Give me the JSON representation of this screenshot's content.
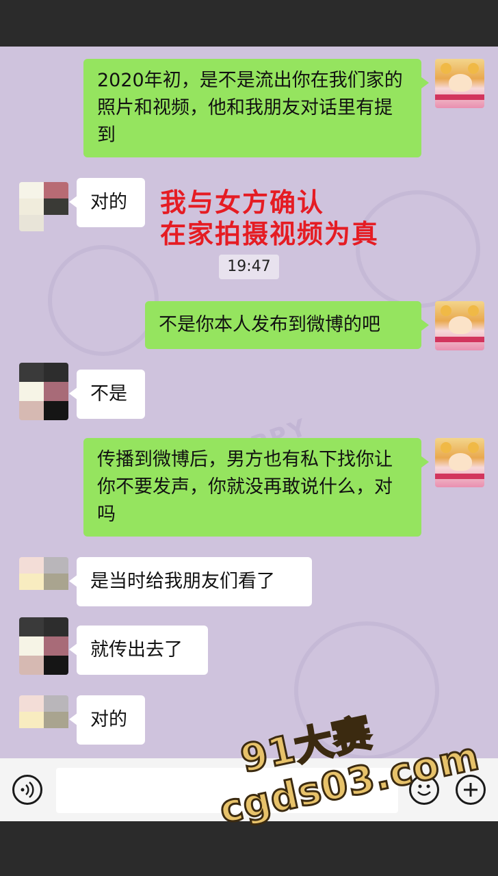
{
  "messages": [
    {
      "side": "right",
      "text": "2020年初，是不是流出你在我们家的照片和视频，他和我朋友对话里有提到"
    },
    {
      "side": "left",
      "text": "对的"
    },
    {
      "side": "right",
      "text": "不是你本人发布到微博的吧"
    },
    {
      "side": "left",
      "text": "不是"
    },
    {
      "side": "right",
      "text": "传播到微博后，男方也有私下找你让你不要发声，你就没再敢说什么，对吗"
    },
    {
      "side": "left",
      "text": "是当时给我朋友们看了"
    },
    {
      "side": "left",
      "text": "就传出去了"
    },
    {
      "side": "left",
      "text": "对的"
    }
  ],
  "timestamp": "19:47",
  "annotation": {
    "line1": "我与女方确认",
    "line2": "在家拍摄视频为真"
  },
  "background_text": "HAPPY",
  "watermark": {
    "line1": "91大赛",
    "line2": "cgds03.com"
  },
  "input_bar": {
    "voice_icon": "voice-icon",
    "emoji_icon": "emoji-icon",
    "add_icon": "plus-icon"
  },
  "colors": {
    "chat_bg": "#cfc3dd",
    "bubble_right": "#95e45f",
    "bubble_left": "#ffffff",
    "annotation": "#e51c23"
  }
}
